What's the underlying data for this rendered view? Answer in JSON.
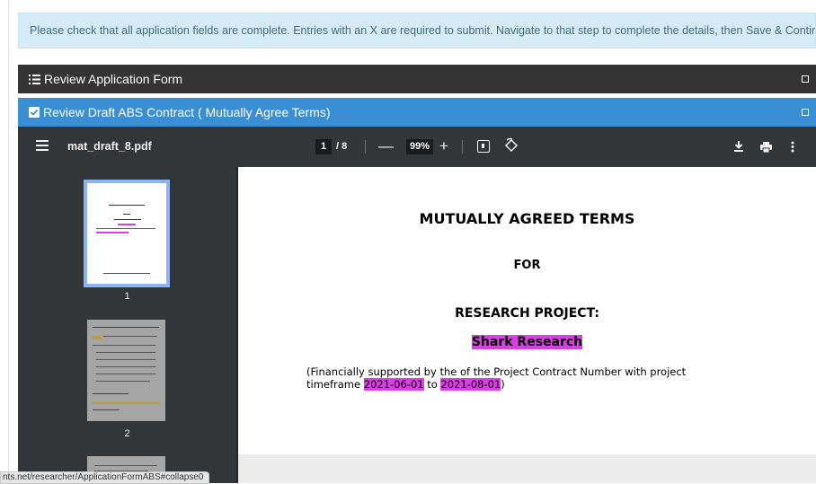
{
  "alert": {
    "text": "Please check that all application fields are complete. Entries with an X are required to submit. Navigate to that step to complete the details, then Save & Continue."
  },
  "panels": [
    {
      "title": "Review Application Form",
      "icon": "list-icon",
      "color": "#343434"
    },
    {
      "title": "Review Draft ABS Contract ( Mutually Agree Terms)",
      "icon": "checkbox-icon",
      "color": "#3a8fd4"
    }
  ],
  "pdf": {
    "file_name": "mat_draft_8.pdf",
    "current_page": "1",
    "total_pages": "/ 8",
    "zoom": "99%",
    "zoom_out": "—",
    "zoom_in": "+",
    "thumbnails": [
      "1",
      "2"
    ],
    "page": {
      "title": "MUTUALLY AGREED TERMS",
      "for": "FOR",
      "subtitle": "RESEARCH PROJECT:",
      "project_name": "Shark Research",
      "para_part1": "(Financially supported by the  of the   Project  Contract Number  with project timeframe ",
      "start_date": "2021-06-01",
      "para_to": " to ",
      "end_date": "2021-08-01",
      "para_end": ")"
    },
    "highlight_color": "#dc3ee6"
  },
  "status_url": "nts.net/researcher/ApplicationFormABS#collapse0"
}
